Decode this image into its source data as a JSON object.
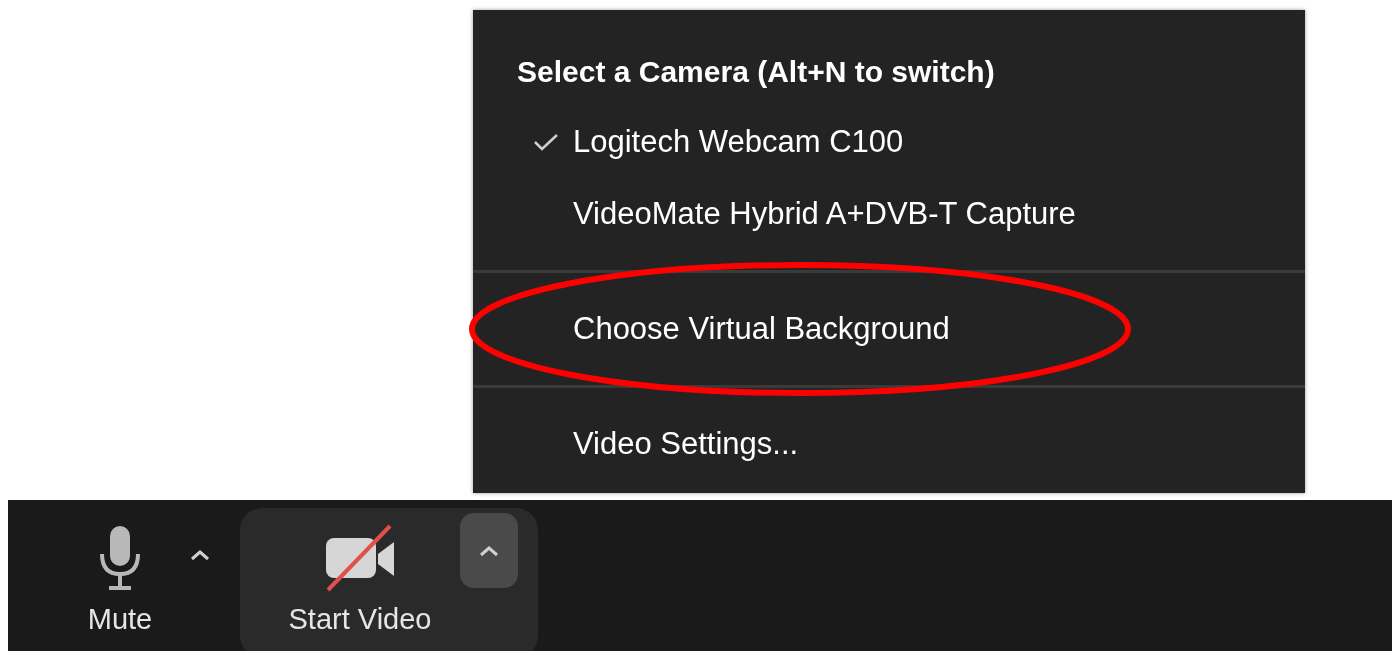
{
  "camera_menu": {
    "title": "Select a Camera (Alt+N to switch)",
    "groups": [
      {
        "items": [
          {
            "label": "Logitech Webcam C100",
            "checked": true,
            "circled": false
          },
          {
            "label": "VideoMate Hybrid A+DVB-T Capture",
            "checked": false,
            "circled": false
          }
        ]
      },
      {
        "items": [
          {
            "label": "Choose Virtual Background",
            "checked": false,
            "circled": true
          }
        ]
      },
      {
        "items": [
          {
            "label": "Video Settings...",
            "checked": false,
            "circled": false
          }
        ]
      }
    ]
  },
  "toolbar": {
    "buttons": [
      {
        "kind": "audio",
        "label": "Mute",
        "muted": false
      },
      {
        "kind": "video",
        "label": "Start Video",
        "video_off": true
      }
    ]
  }
}
